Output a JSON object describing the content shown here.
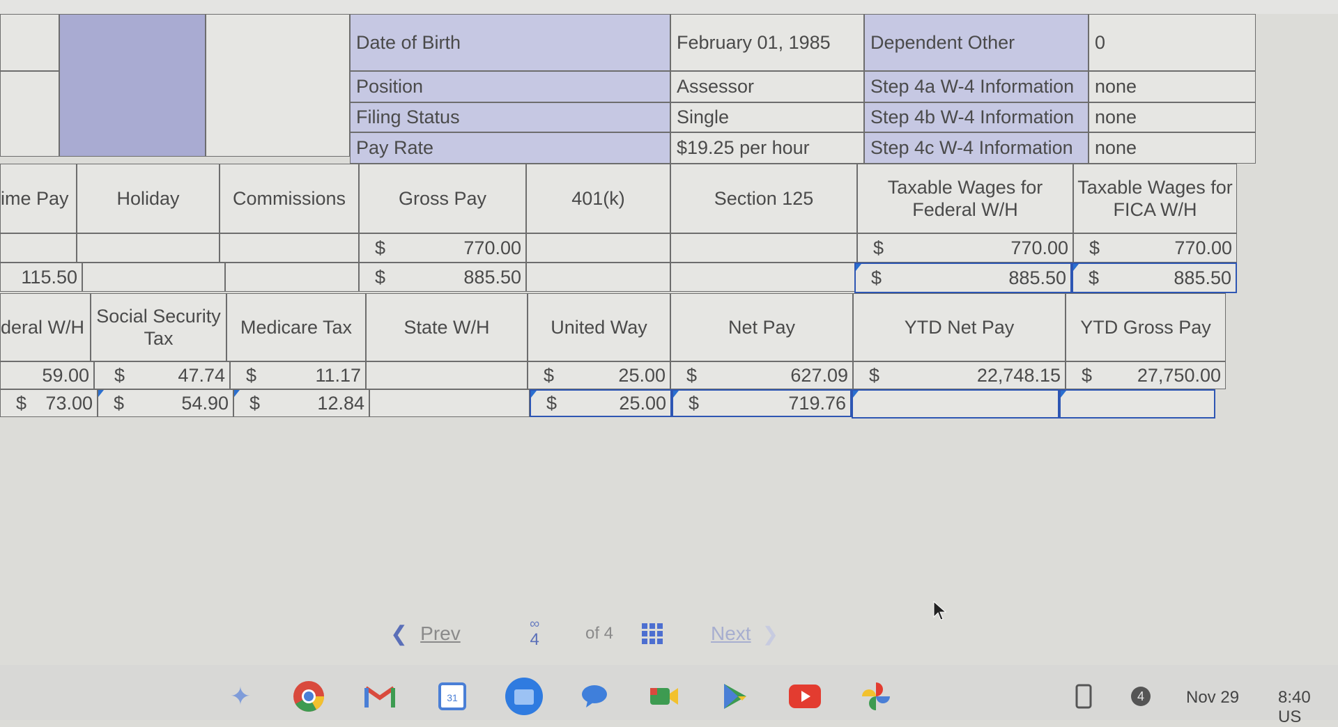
{
  "info": {
    "dob_label": "Date of Birth",
    "dob_value": "February 01, 1985",
    "dep_label": "Dependent Other",
    "dep_value": "0",
    "position_label": "Position",
    "position_value": "Assessor",
    "step4a_label": "Step 4a W-4 Information",
    "step4a_value": "none",
    "filing_label": "Filing Status",
    "filing_value": "Single",
    "step4b_label": "Step 4b W-4 Information",
    "step4b_value": "none",
    "payrate_label": "Pay Rate",
    "payrate_value": "$19.25 per hour",
    "step4c_label": "Step 4c W-4 Information",
    "step4c_value": "none"
  },
  "headers1": {
    "overtime": "ime Pay",
    "holiday": "Holiday",
    "commissions": "Commissions",
    "gross": "Gross Pay",
    "k401": "401(k)",
    "sec125": "Section 125",
    "taxable_fed": "Taxable Wages for Federal W/H",
    "taxable_fica": "Taxable Wages for FICA W/H"
  },
  "row1": {
    "gross_cur": "$",
    "gross": "770.00",
    "fed_cur": "$",
    "fed": "770.00",
    "fica_cur": "$",
    "fica": "770.00"
  },
  "row2": {
    "overtime": "115.50",
    "gross_cur": "$",
    "gross": "885.50",
    "fed_cur": "$",
    "fed": "885.50",
    "fica_cur": "$",
    "fica": "885.50"
  },
  "headers2": {
    "fed_wh": "deral W/H",
    "ss": "Social Security Tax",
    "medicare": "Medicare Tax",
    "state": "State W/H",
    "united": "United Way",
    "net": "Net Pay",
    "ytd_net": "YTD Net Pay",
    "ytd_gross": "YTD Gross Pay"
  },
  "row3": {
    "fed": "59.00",
    "ss_cur": "$",
    "ss": "47.74",
    "med_cur": "$",
    "med": "11.17",
    "uw_cur": "$",
    "uw": "25.00",
    "net_cur": "$",
    "net": "627.09",
    "ytdnet_cur": "$",
    "ytdnet": "22,748.15",
    "ytdgross_cur": "$",
    "ytdgross": "27,750.00"
  },
  "row4": {
    "fed_cur": "$",
    "fed": "73.00",
    "ss_cur": "$",
    "ss": "54.90",
    "med_cur": "$",
    "med": "12.84",
    "uw_cur": "$",
    "uw": "25.00",
    "net_cur": "$",
    "net": "719.76"
  },
  "nav": {
    "prev": "Prev",
    "page": "4",
    "of": "of 4",
    "next": "Next"
  },
  "taskbar": {
    "apps": [
      "launcher-icon",
      "chrome-icon",
      "gmail-icon",
      "calendar-icon",
      "files-icon",
      "chat-icon",
      "meet-icon",
      "play-store-icon",
      "youtube-icon",
      "photos-icon"
    ],
    "badge": "4",
    "date": "Nov 29",
    "time": "8:40 US"
  },
  "colors": {
    "header_blue": "#c6c8e3",
    "shaded_block": "#a9abd2",
    "selection": "#2e56b3"
  }
}
